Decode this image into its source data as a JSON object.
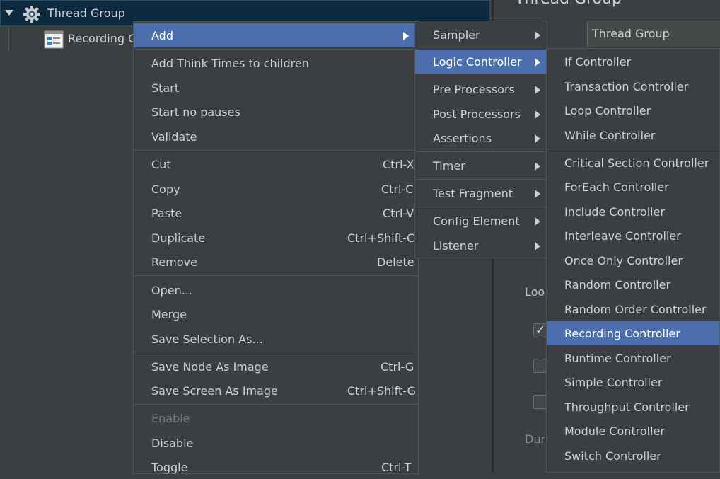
{
  "tree": {
    "root_label": "Thread Group",
    "child_label": "Recording C"
  },
  "editor": {
    "title": "Thread Group",
    "name_value": "Thread Group",
    "loop_label": "Loo",
    "duration_label": "Dura"
  },
  "context_menu": {
    "add": "Add",
    "add_think_times": "Add Think Times to children",
    "start": "Start",
    "start_no_pauses": "Start no pauses",
    "validate": "Validate",
    "cut": "Cut",
    "cut_sc": "Ctrl-X",
    "copy": "Copy",
    "copy_sc": "Ctrl-C",
    "paste": "Paste",
    "paste_sc": "Ctrl-V",
    "duplicate": "Duplicate",
    "duplicate_sc": "Ctrl+Shift-C",
    "remove": "Remove",
    "remove_sc": "Delete",
    "open": "Open...",
    "merge": "Merge",
    "save_selection": "Save Selection As...",
    "save_node_image": "Save Node As Image",
    "save_node_image_sc": "Ctrl-G",
    "save_screen_image": "Save Screen As Image",
    "save_screen_image_sc": "Ctrl+Shift-G",
    "enable": "Enable",
    "disable": "Disable",
    "toggle": "Toggle",
    "toggle_sc": "Ctrl-T"
  },
  "add_menu": {
    "sampler": "Sampler",
    "logic_controller": "Logic Controller",
    "pre_processors": "Pre Processors",
    "post_processors": "Post Processors",
    "assertions": "Assertions",
    "timer": "Timer",
    "test_fragment": "Test Fragment",
    "config_element": "Config Element",
    "listener": "Listener"
  },
  "logic_menu": {
    "if": "If Controller",
    "transaction": "Transaction Controller",
    "loop": "Loop Controller",
    "while": "While Controller",
    "critical_section": "Critical Section Controller",
    "foreach": "ForEach Controller",
    "include": "Include Controller",
    "interleave": "Interleave Controller",
    "once_only": "Once Only Controller",
    "random": "Random Controller",
    "random_order": "Random Order Controller",
    "recording": "Recording Controller",
    "runtime": "Runtime Controller",
    "simple": "Simple Controller",
    "throughput": "Throughput Controller",
    "module": "Module Controller",
    "switch": "Switch Controller"
  },
  "colors": {
    "background": "#3c3f41",
    "selection": "#4b6eaf",
    "tree_selection": "#0d293e",
    "text": "#cfcfcf",
    "disabled_text": "#777777"
  },
  "icons": {
    "tree_expand": "triangle-down-icon",
    "thread_group": "gear-icon",
    "recording_controller": "document-icon",
    "submenu": "chevron-right-icon"
  }
}
